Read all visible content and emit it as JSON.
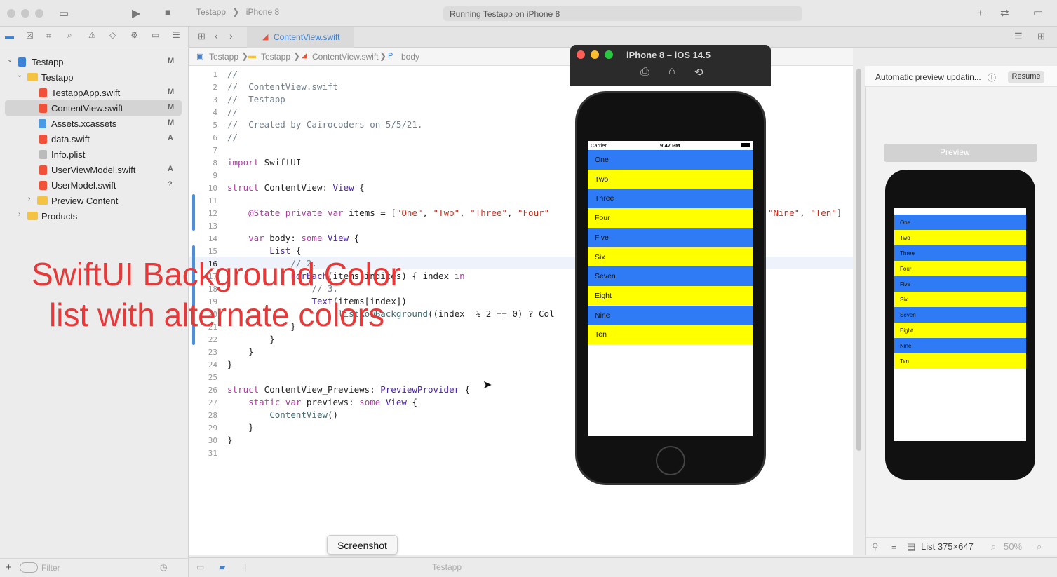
{
  "toolbar": {
    "scheme_project": "Testapp",
    "scheme_device": "iPhone 8",
    "status": "Running Testapp on iPhone 8"
  },
  "navigator": {
    "items": [
      {
        "label": "Testapp",
        "badge": "M"
      },
      {
        "label": "Testapp",
        "badge": ""
      },
      {
        "label": "TestappApp.swift",
        "badge": "M"
      },
      {
        "label": "ContentView.swift",
        "badge": "M"
      },
      {
        "label": "Assets.xcassets",
        "badge": "M"
      },
      {
        "label": "data.swift",
        "badge": "A"
      },
      {
        "label": "Info.plist",
        "badge": ""
      },
      {
        "label": "UserViewModel.swift",
        "badge": "A"
      },
      {
        "label": "UserModel.swift",
        "badge": "?"
      },
      {
        "label": "Preview Content",
        "badge": ""
      },
      {
        "label": "Products",
        "badge": ""
      }
    ],
    "filter_placeholder": "Filter"
  },
  "editor": {
    "tab": "ContentView.swift",
    "breadcrumb": [
      "Testapp",
      "Testapp",
      "ContentView.swift",
      "body"
    ],
    "lines": [
      "1",
      "2",
      "3",
      "4",
      "5",
      "6",
      "7",
      "8",
      "9",
      "10",
      "11",
      "12",
      "13",
      "14",
      "15",
      "16",
      "17",
      "18",
      "19",
      "20",
      "21",
      "22",
      "23",
      "24",
      "25",
      "26",
      "27",
      "28",
      "29",
      "30",
      "31"
    ]
  },
  "overlay": {
    "title": "SwiftUI Background Color",
    "subtitle": "list with alternate colors"
  },
  "simulator": {
    "title": "iPhone 8 – iOS 14.5",
    "carrier": "Carrier",
    "time": "9:47 PM",
    "items": [
      "One",
      "Two",
      "Three",
      "Four",
      "Five",
      "Six",
      "Seven",
      "Eight",
      "Nine",
      "Ten"
    ],
    "colors": {
      "blue": "#2f7bf5",
      "yellow": "#ffff00"
    }
  },
  "canvas": {
    "status": "Automatic preview updatin...",
    "resume": "Resume",
    "preview_label": "Preview",
    "list_size": "List 375×647",
    "zoom": "50%"
  },
  "tooltip": "Screenshot",
  "debug": {
    "target": "Testapp"
  }
}
